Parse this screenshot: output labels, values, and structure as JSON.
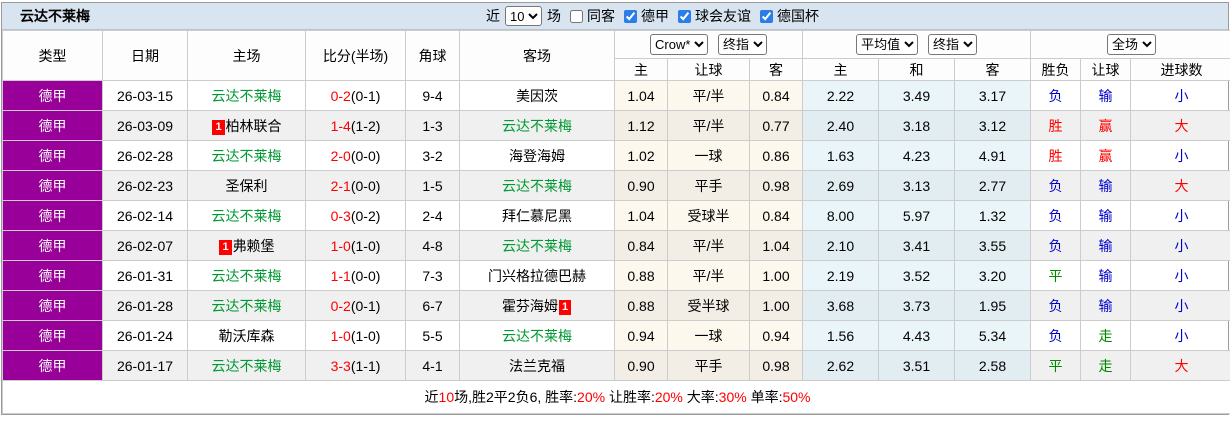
{
  "title": "云达不莱梅",
  "toolbar": {
    "recent_label": "近",
    "matches_count": "10",
    "matches_label": "场",
    "checkboxes": [
      {
        "label": "同客",
        "checked": false
      },
      {
        "label": "德甲",
        "checked": true
      },
      {
        "label": "球会友谊",
        "checked": true
      },
      {
        "label": "德国杯",
        "checked": true
      }
    ]
  },
  "header": {
    "type": "类型",
    "date": "日期",
    "home": "主场",
    "score": "比分(半场)",
    "corner": "角球",
    "away": "客场",
    "crow_select": "Crow*",
    "crow_final_select": "终指",
    "avg_select": "平均值",
    "avg_final_select": "终指",
    "scope_select": "全场",
    "sub": {
      "home": "主",
      "handicap": "让球",
      "away": "客",
      "avg_home": "主",
      "avg_draw": "和",
      "avg_away": "客",
      "result_wl": "胜负",
      "result_handicap": "让球",
      "result_goals": "进球数"
    }
  },
  "rows": [
    {
      "league": "德甲",
      "date": "26-03-15",
      "home": "云达不莱梅",
      "score_ft": "0-2",
      "score_ht": "(0-1)",
      "corner": "9-4",
      "away": "美因茨",
      "crow": [
        "1.04",
        "平/半",
        "0.84"
      ],
      "avg": [
        "2.22",
        "3.49",
        "3.17"
      ],
      "result": [
        "负",
        "输",
        "小"
      ]
    },
    {
      "league": "德甲",
      "date": "26-03-09",
      "home_badge": "1",
      "home": "柏林联合",
      "score_ft": "1-4",
      "score_ht": "(1-2)",
      "corner": "1-3",
      "away": "云达不莱梅",
      "crow": [
        "1.12",
        "平/半",
        "0.77"
      ],
      "avg": [
        "2.40",
        "3.18",
        "3.12"
      ],
      "result": [
        "胜",
        "赢",
        "大"
      ]
    },
    {
      "league": "德甲",
      "date": "26-02-28",
      "home": "云达不莱梅",
      "score_ft": "2-0",
      "score_ht": "(0-0)",
      "corner": "3-2",
      "away": "海登海姆",
      "crow": [
        "1.02",
        "一球",
        "0.86"
      ],
      "avg": [
        "1.63",
        "4.23",
        "4.91"
      ],
      "result": [
        "胜",
        "赢",
        "小"
      ]
    },
    {
      "league": "德甲",
      "date": "26-02-23",
      "home": "圣保利",
      "score_ft": "2-1",
      "score_ht": "(0-0)",
      "corner": "1-5",
      "away": "云达不莱梅",
      "crow": [
        "0.90",
        "平手",
        "0.98"
      ],
      "avg": [
        "2.69",
        "3.13",
        "2.77"
      ],
      "result": [
        "负",
        "输",
        "大"
      ]
    },
    {
      "league": "德甲",
      "date": "26-02-14",
      "home": "云达不莱梅",
      "score_ft": "0-3",
      "score_ht": "(0-2)",
      "corner": "2-4",
      "away": "拜仁慕尼黑",
      "crow": [
        "1.04",
        "受球半",
        "0.84"
      ],
      "avg": [
        "8.00",
        "5.97",
        "1.32"
      ],
      "result": [
        "负",
        "输",
        "小"
      ]
    },
    {
      "league": "德甲",
      "date": "26-02-07",
      "home_badge": "1",
      "home": "弗赖堡",
      "score_ft": "1-0",
      "score_ht": "(1-0)",
      "corner": "4-8",
      "away": "云达不莱梅",
      "crow": [
        "0.84",
        "平/半",
        "1.04"
      ],
      "avg": [
        "2.10",
        "3.41",
        "3.55"
      ],
      "result": [
        "负",
        "输",
        "小"
      ]
    },
    {
      "league": "德甲",
      "date": "26-01-31",
      "home": "云达不莱梅",
      "score_ft": "1-1",
      "score_ht": "(0-0)",
      "corner": "7-3",
      "away": "门兴格拉德巴赫",
      "crow": [
        "0.88",
        "平/半",
        "1.00"
      ],
      "avg": [
        "2.19",
        "3.52",
        "3.20"
      ],
      "result": [
        "平",
        "输",
        "小"
      ]
    },
    {
      "league": "德甲",
      "date": "26-01-28",
      "home": "云达不莱梅",
      "score_ft": "0-2",
      "score_ht": "(0-1)",
      "corner": "6-7",
      "away": "霍芬海姆",
      "away_badge": "1",
      "crow": [
        "0.88",
        "受半球",
        "1.00"
      ],
      "avg": [
        "3.68",
        "3.73",
        "1.95"
      ],
      "result": [
        "负",
        "输",
        "小"
      ]
    },
    {
      "league": "德甲",
      "date": "26-01-24",
      "home": "勒沃库森",
      "score_ft": "1-0",
      "score_ht": "(1-0)",
      "corner": "5-5",
      "away": "云达不莱梅",
      "crow": [
        "0.94",
        "一球",
        "0.94"
      ],
      "avg": [
        "1.56",
        "4.43",
        "5.34"
      ],
      "result": [
        "负",
        "走",
        "小"
      ]
    },
    {
      "league": "德甲",
      "date": "26-01-17",
      "home": "云达不莱梅",
      "score_ft": "3-3",
      "score_ht": "(1-1)",
      "corner": "4-1",
      "away": "法兰克福",
      "crow": [
        "0.90",
        "平手",
        "0.98"
      ],
      "avg": [
        "2.62",
        "3.51",
        "2.58"
      ],
      "result": [
        "平",
        "走",
        "大"
      ]
    }
  ],
  "footer": {
    "p1": "近",
    "n1": "10",
    "p2": "场,胜2平2负6, 胜率:",
    "n2": "20%",
    "p3": " 让胜率:",
    "n3": "20%",
    "p4": " 大率:",
    "n4": "30%",
    "p5": " 单率:",
    "n5": "50%"
  },
  "colors": {
    "league_bg": "#990099",
    "team_highlight_green": "#009933",
    "score_red": "#ff0000",
    "win_red": "#ff0000",
    "lose_blue": "#0000cc",
    "draw_green": "#008800",
    "titlebar_bg": "#d9e4f1",
    "crow_col_tint": "#fdf8ee",
    "avg_col_tint": "#eaf5fa"
  }
}
